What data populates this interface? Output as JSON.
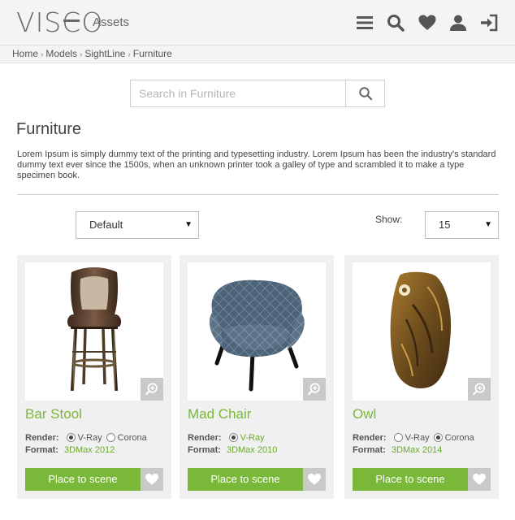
{
  "header": {
    "logo": "VISCO",
    "logo_parts": {
      "a": "VIS",
      "b": "C",
      "c": "O"
    },
    "section": "Assets",
    "icons": [
      "menu-icon",
      "search-icon",
      "heart-icon",
      "user-icon",
      "login-icon"
    ]
  },
  "breadcrumb": [
    "Home",
    "Models",
    "SightLine",
    "Furniture"
  ],
  "search": {
    "placeholder": "Search in Furniture",
    "value": ""
  },
  "page": {
    "title": "Furniture",
    "description": "Lorem Ipsum is simply dummy text of the printing and typesetting industry. Lorem Ipsum has been the industry's standard dummy text ever since the 1500s, when an unknown printer took a galley of type and scrambled it to make a type specimen book."
  },
  "controls": {
    "sort_value": "Default",
    "show_label": "Show:",
    "show_value": "15"
  },
  "labels": {
    "render": "Render:",
    "format": "Format:",
    "place": "Place to scene",
    "vray": "V-Ray",
    "corona": "Corona"
  },
  "products": [
    {
      "name": "Bar Stool",
      "render": "V-Ray",
      "format": "3DMax 2012"
    },
    {
      "name": "Mad Chair",
      "render": "V-Ray",
      "format": "3DMax 2010"
    },
    {
      "name": "Owl",
      "render": "Corona",
      "format": "3DMax 2014"
    }
  ],
  "colors": {
    "accent": "#7ab83a",
    "header_bg": "#f4f4f4",
    "card_bg": "#f0f0f0",
    "icon": "#555555"
  }
}
